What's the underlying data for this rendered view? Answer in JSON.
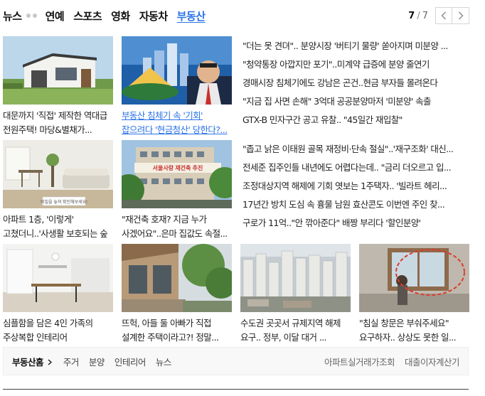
{
  "tabs": [
    "뉴스",
    "연예",
    "스포츠",
    "영화",
    "자동차",
    "부동산"
  ],
  "active_tab": "부동산",
  "pager": {
    "current": "7",
    "separator": "/",
    "total": "7",
    "prev_icon": "chevron-left-icon",
    "next_icon": "chevron-right-icon"
  },
  "row1": {
    "cards": [
      {
        "caption": "대문까지 '직접' 제작한 역대급 전원주택! 마당&별채가..."
      },
      {
        "caption": "부동산 침체기 속 '기회' 잡으려다 '현금청산' 당한다?..."
      }
    ],
    "list": [
      "\"더는 못 견뎌\".. 분양시장 '버티기 물량' 쏟아지며 미분양 ...",
      "\"청약통장 아깝지만 포기\"..미계약 급증에 분양 줄연기",
      "경매시장 침체기에도 강남은 곤건..현금 부자들 몰려온다",
      "\"지금 집 사면 손해\" 3억대 공공분양마저 '미분양' 속출",
      "GTX-B 민자구간 공고 유찰.. \"45일간 재입찰\""
    ]
  },
  "row2": {
    "cards": [
      {
        "caption": "아파트 1층, '이렇게' 고쳤더니..'사생활 보호되는 숲 속..."
      },
      {
        "caption": "\"재건축 호재? 지금 누가 사겠어요\"..은마 집값도 속절..."
      }
    ],
    "list": [
      "\"좁고 낡은 이태원 골목 재정비·단속 절실\"..'재구조화' 대신...",
      "전세준 집주인들 내년에도 어렵다는데.. \"금리 더오르고 입...",
      "조정대상지역 해제에 기회 엿보는 1주택자.. '빌라트 헤리...",
      "17년간 방치 도심 속 흉물 남원 효산콘도 이번엔 주인 찾...",
      "구로가 11억..\"안 깎아준다\" 배짱 부리다 '할인분양'"
    ]
  },
  "row3": {
    "cards": [
      {
        "caption": "심플함을 담은 4인 가족의 주상복합 인테리어"
      },
      {
        "caption": "뜨헉, 아들 둘 아빠가 직접 설계한 주택이라고?! 정말..."
      },
      {
        "caption": "수도권 곳곳서 규제지역 해제 요구.. 정부, 이달 대거 ..."
      },
      {
        "caption": "\"침실 창문은 부숴주세요\" 요구하자.. 상상도 못한 일..."
      }
    ]
  },
  "thumb_texts": {
    "banner": "서울사랑 재건축 추진",
    "sticker": "비밀을 놓쳐 확인해보세요!"
  },
  "bottom": {
    "home": "부동산홈",
    "home_icon": "chevron-right-icon",
    "categories": [
      "주거",
      "분양",
      "인테리어",
      "뉴스"
    ],
    "tools": [
      "아파트실거래가조회",
      "대출이자계산기"
    ]
  },
  "colors": {
    "accent": "#2a73e8",
    "text": "#222222",
    "bar_bg": "#f8f8f8"
  }
}
